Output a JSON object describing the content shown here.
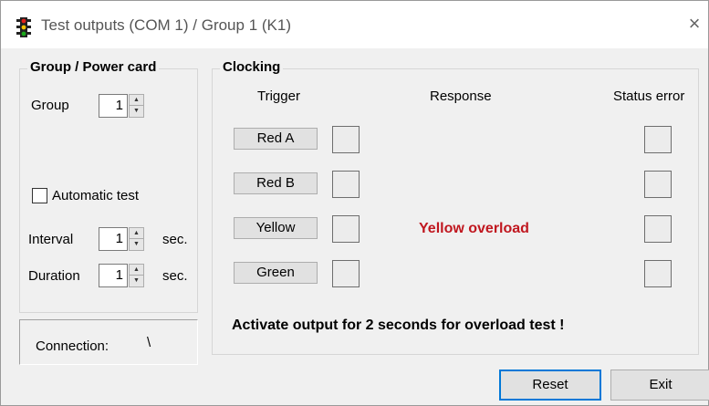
{
  "window": {
    "title": "Test outputs (COM 1) / Group 1 (K1)",
    "close_symbol": "×",
    "icon": "traffic-light-icon"
  },
  "group_panel": {
    "legend": "Group / Power card",
    "group_label": "Group",
    "group_value": "1",
    "automatic_test_label": "Automatic test",
    "automatic_test_checked": false,
    "interval_label": "Interval",
    "interval_value": "1",
    "interval_unit": "sec.",
    "duration_label": "Duration",
    "duration_value": "1",
    "duration_unit": "sec."
  },
  "connection": {
    "label": "Connection:",
    "value": "\\"
  },
  "clocking": {
    "legend": "Clocking",
    "headers": {
      "trigger": "Trigger",
      "response": "Response",
      "status_error": "Status error"
    },
    "rows": [
      {
        "trigger": "Red A",
        "response": ""
      },
      {
        "trigger": "Red B",
        "response": ""
      },
      {
        "trigger": "Yellow",
        "response": "Yellow overload"
      },
      {
        "trigger": "Green",
        "response": ""
      }
    ],
    "note": "Activate output for 2 seconds for overload test !"
  },
  "buttons": {
    "reset": "Reset",
    "exit": "Exit"
  },
  "colors": {
    "overload_text": "#c0171f",
    "default_button_border": "#0078d7"
  },
  "spinner_icons": {
    "up": "▲",
    "down": "▼"
  }
}
